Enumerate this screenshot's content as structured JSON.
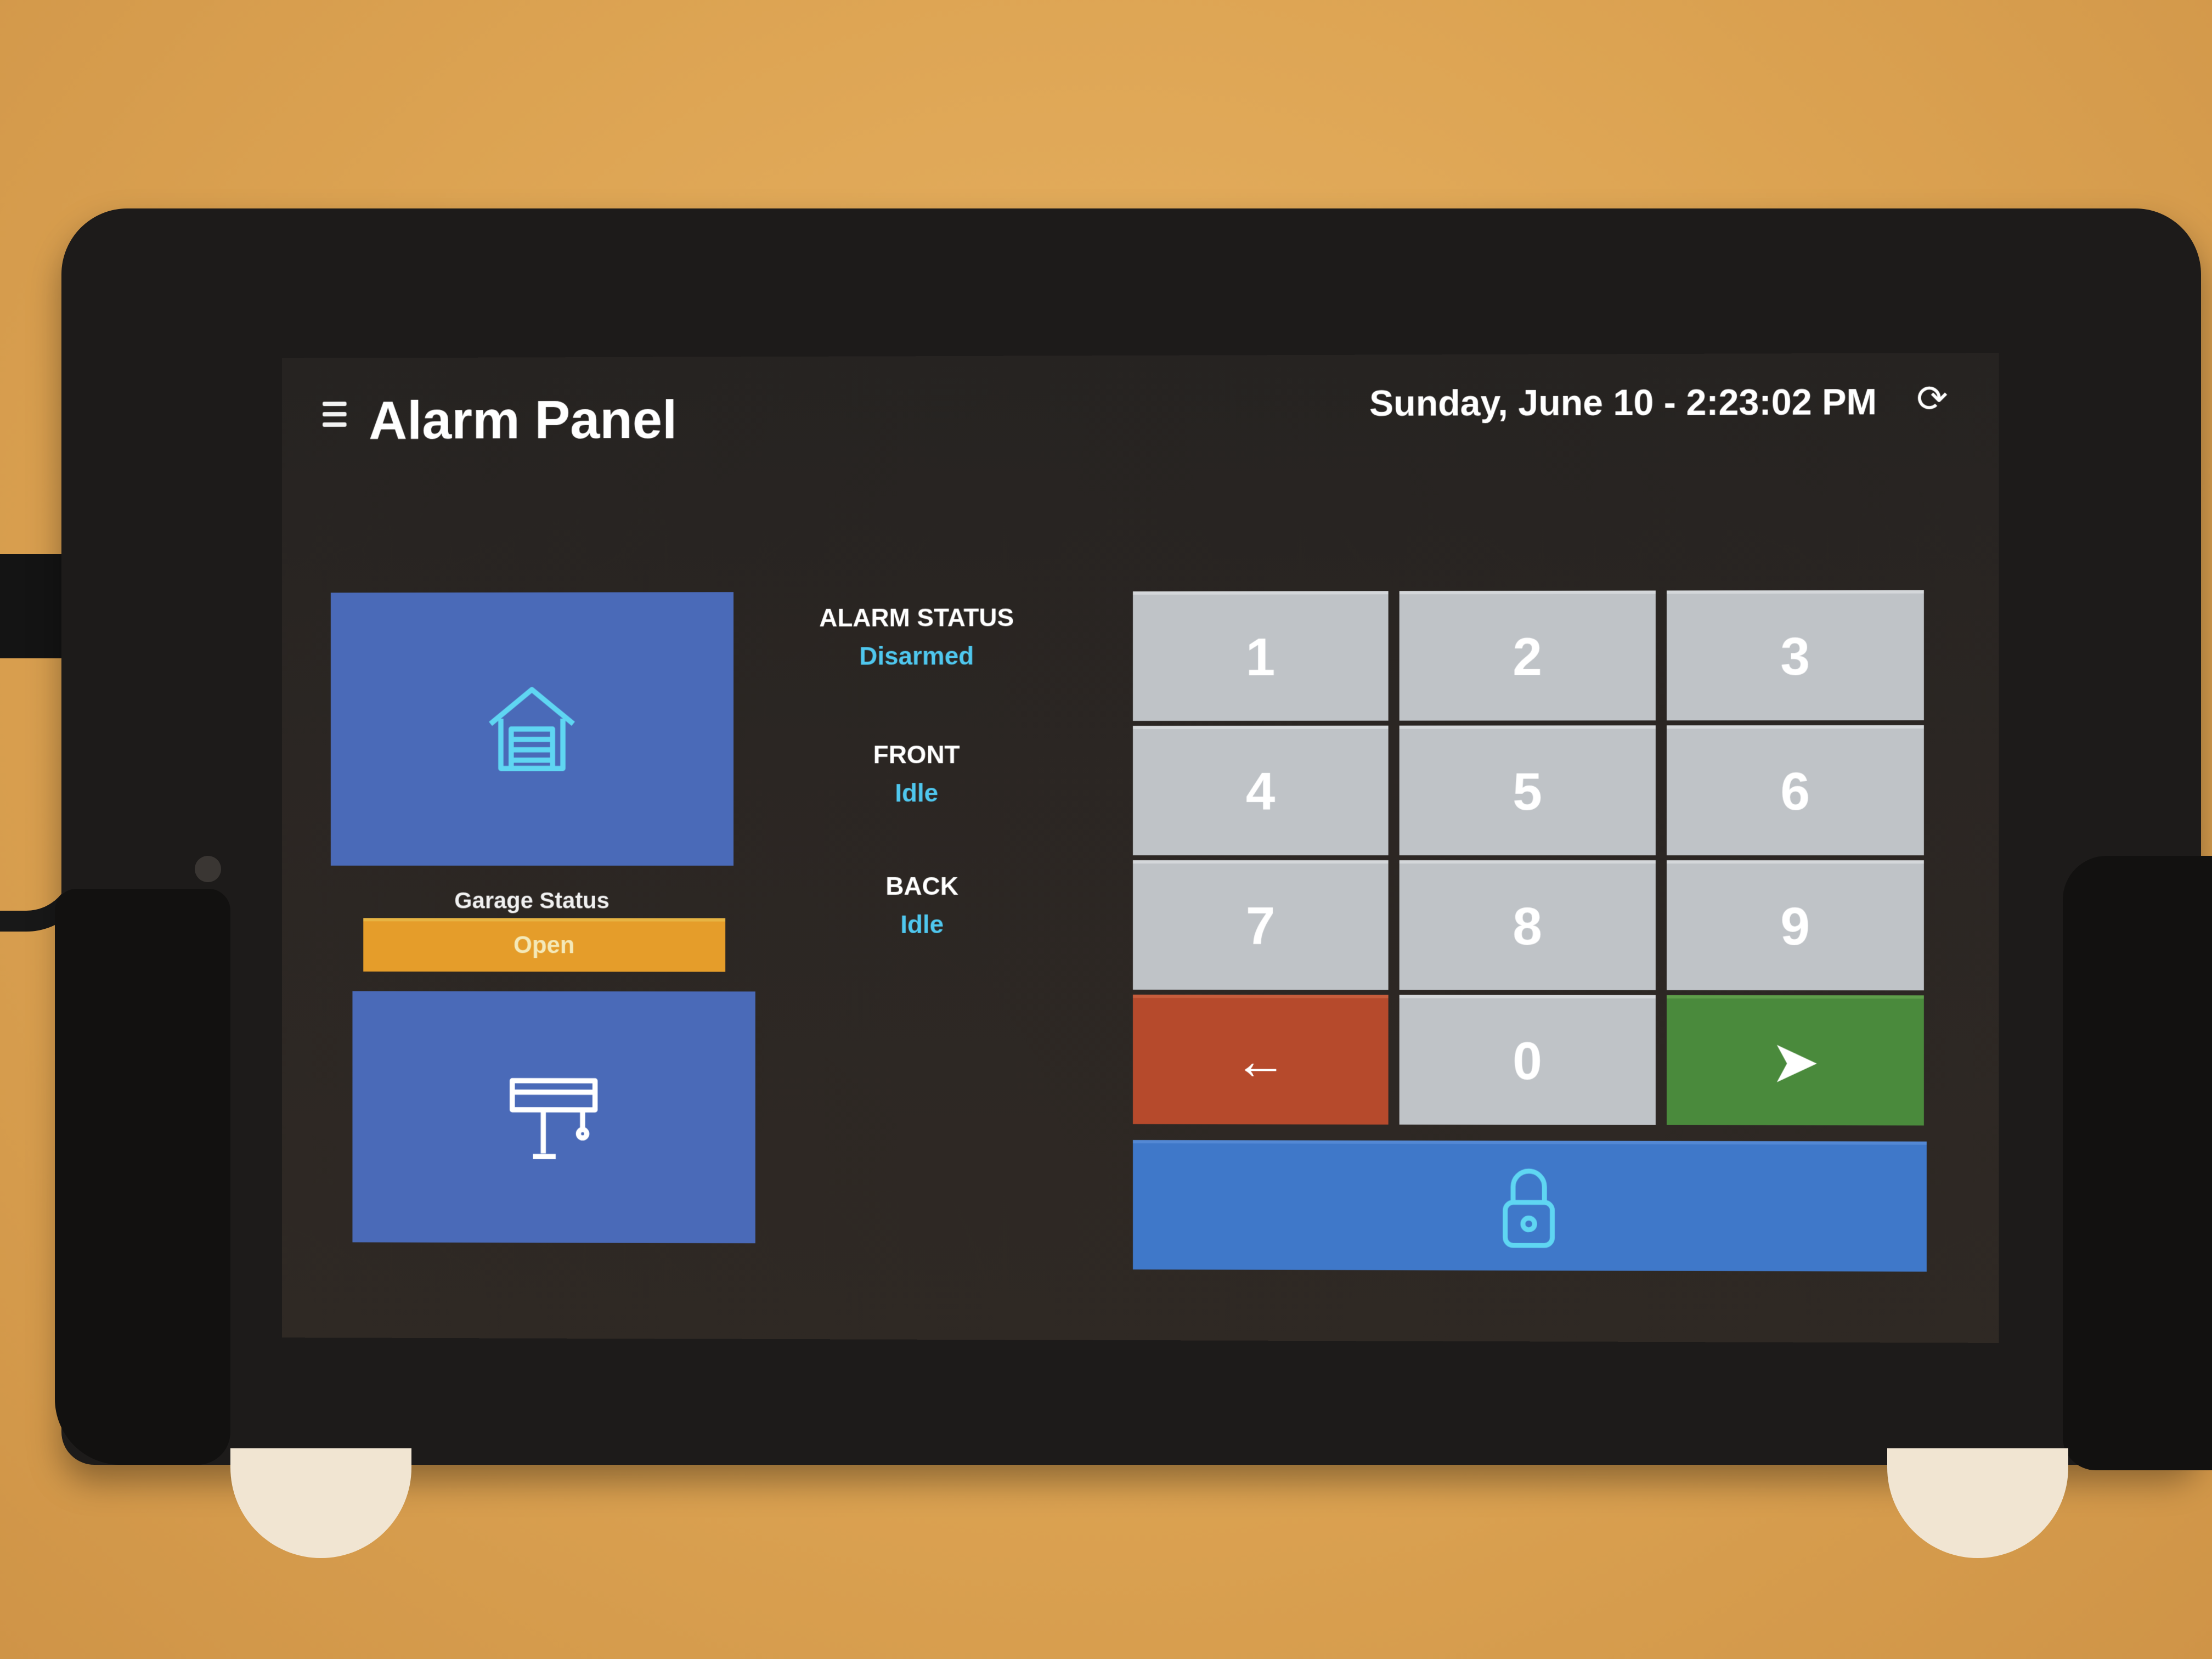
{
  "app": {
    "title": "Alarm Panel"
  },
  "header": {
    "datetime": "Sunday, June 10 - 2:23:02 PM"
  },
  "tiles": {
    "garage": {
      "icon": "garage-icon"
    },
    "gate": {
      "icon": "gate-icon"
    }
  },
  "garage_status": {
    "label": "Garage Status",
    "value": "Open",
    "color": "#e59d2a"
  },
  "statuses": [
    {
      "label": "ALARM STATUS",
      "value": "Disarmed"
    },
    {
      "label": "FRONT",
      "value": "Idle"
    },
    {
      "label": "BACK",
      "value": "Idle"
    }
  ],
  "keypad": {
    "keys": [
      "1",
      "2",
      "3",
      "4",
      "5",
      "6",
      "7",
      "8",
      "9"
    ],
    "zero": "0",
    "backspace": "←",
    "enter": "➤",
    "backspace_color": "#b64a2c",
    "enter_color": "#4a8a3c"
  },
  "lock": {
    "icon": "lock-icon",
    "color": "#3f78c9"
  }
}
